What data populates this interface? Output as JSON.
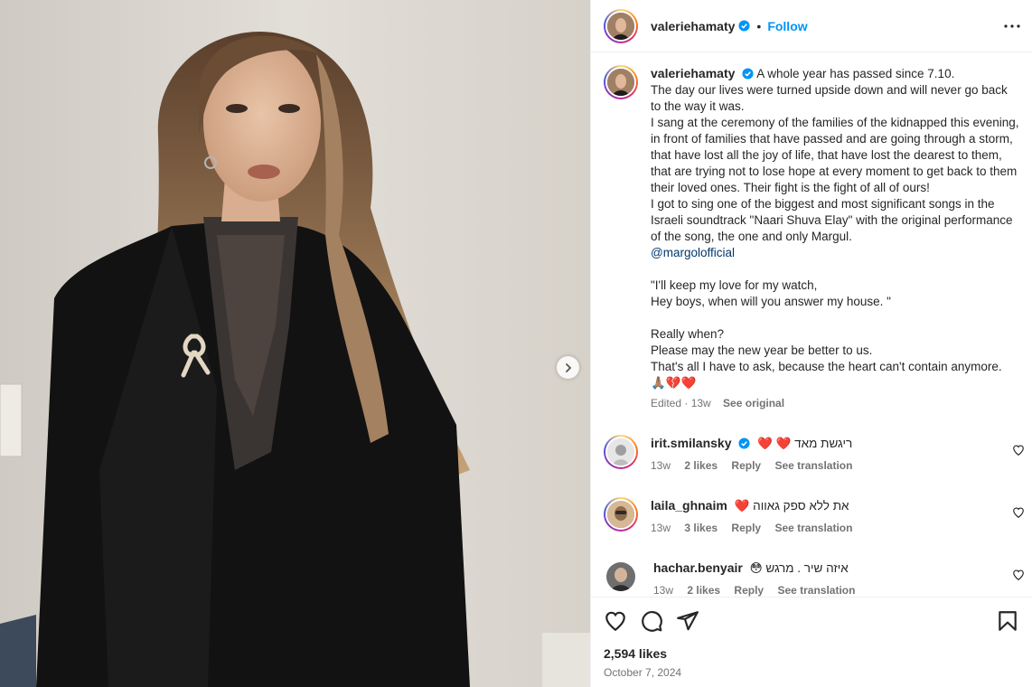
{
  "post": {
    "username": "valeriehamaty",
    "verified": true,
    "follow_label": "Follow",
    "separator": "•",
    "more_label": "More options",
    "caption_lines": [
      "A whole year has passed since 7.10.",
      "The day our lives were turned upside down and will never go back to the way it was.",
      "I sang at the ceremony of the families of the kidnapped this evening, in front of families that have passed and are going through a storm, that have lost all the joy of life, that have lost the dearest to them, that are trying not to lose hope at every moment to get back to them their loved ones. Their fight is the fight of all of ours!",
      "I got to sing one of the biggest and most significant songs in the Israeli soundtrack \"Naari Shuva Elay\" with the original performance of the song, the one and only Margul."
    ],
    "mention": "@margolofficial",
    "quote_lines": [
      "\"I'll keep my love for my watch,",
      "Hey boys, when will you answer my house. \""
    ],
    "closing_lines": [
      "Really when?",
      "Please may the new year be better to us.",
      "That's all I have to ask, because the heart can't contain anymore."
    ],
    "emoji_line": "🙏🏽💔❤️",
    "caption_meta": {
      "edited": "Edited · 13w",
      "see_original": "See original"
    },
    "likes": "2,594 likes",
    "date": "October 7, 2024"
  },
  "comments": [
    {
      "username": "irit.smilansky",
      "verified": true,
      "text": "❤️ ❤️ ריגשת מאד",
      "time": "13w",
      "likes": "2 likes",
      "reply": "Reply",
      "translate": "See translation",
      "avatar_color": "#e8e8e8"
    },
    {
      "username": "laila_ghnaim",
      "verified": false,
      "text": "❤️ את ללא ספק גאווה",
      "time": "13w",
      "likes": "3 likes",
      "reply": "Reply",
      "translate": "See translation",
      "avatar_color": "#c9a27a"
    },
    {
      "username": "hachar.benyair",
      "verified": false,
      "text": "😳 איזה שיר . מרגש",
      "time": "13w",
      "likes": "2 likes",
      "reply": "Reply",
      "translate": "See translation",
      "avatar_color": "#5a5a5a"
    }
  ],
  "icons": {
    "like": "heart-icon",
    "comment": "comment-icon",
    "share": "share-icon",
    "save": "bookmark-icon",
    "next": "chevron-right-icon",
    "more": "ellipsis-icon"
  },
  "colors": {
    "accent": "#0095f6",
    "link": "#00376b",
    "muted": "#737373",
    "verified": "#0095f6"
  }
}
